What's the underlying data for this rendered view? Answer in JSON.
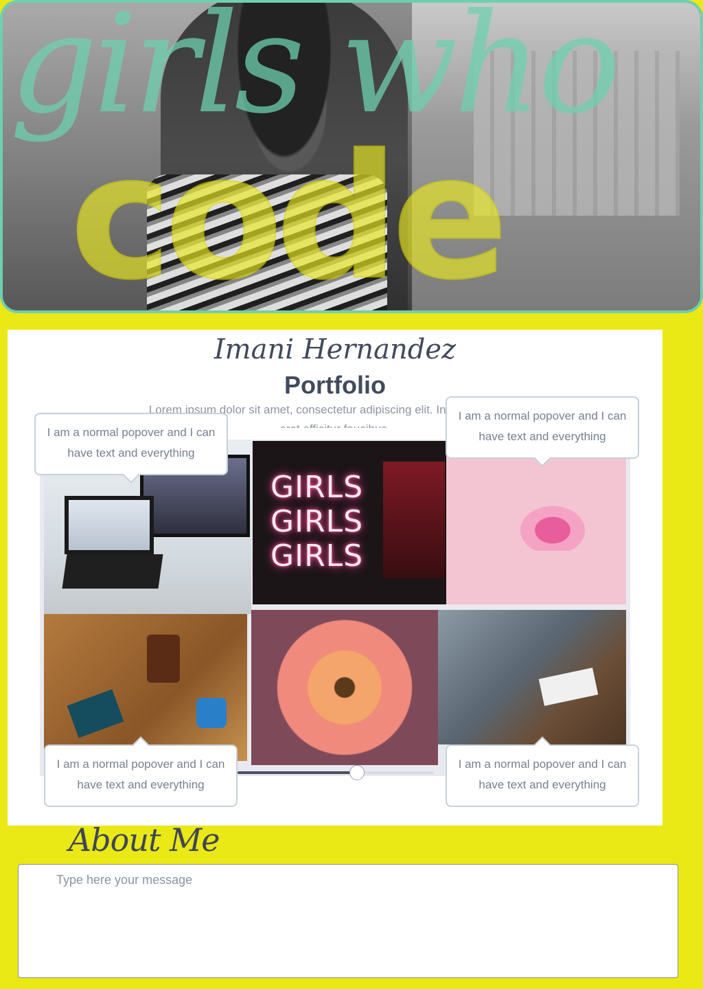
{
  "hero": {
    "script_text": "girls who",
    "block_text": "code"
  },
  "portfolio": {
    "owner_name": "Imani Hernandez",
    "title": "Portfolio",
    "intro": "Lorem ipsum dolor sit amet, consectetur adipiscing elit. In nec nibh vitae erat efficitur faucibus.",
    "neon_text": [
      "GIRLS",
      "GIRLS",
      "GIRLS"
    ],
    "slider_progress": 0.61
  },
  "popovers": [
    {
      "text": "I am a normal popover and I can have text and everything"
    },
    {
      "text": "I am a normal popover and I can have text and everything"
    },
    {
      "text": "I am a normal popover and I can have text and everything"
    },
    {
      "text": "I am a normal popover and I can have text and everything"
    }
  ],
  "about": {
    "title": "About Me",
    "message_placeholder": "Type here your message"
  },
  "colors": {
    "page_background": "#eae815",
    "hero_border": "#6fcfae",
    "script_overlay": "#6fd0b0",
    "block_overlay": "#eaea22"
  }
}
